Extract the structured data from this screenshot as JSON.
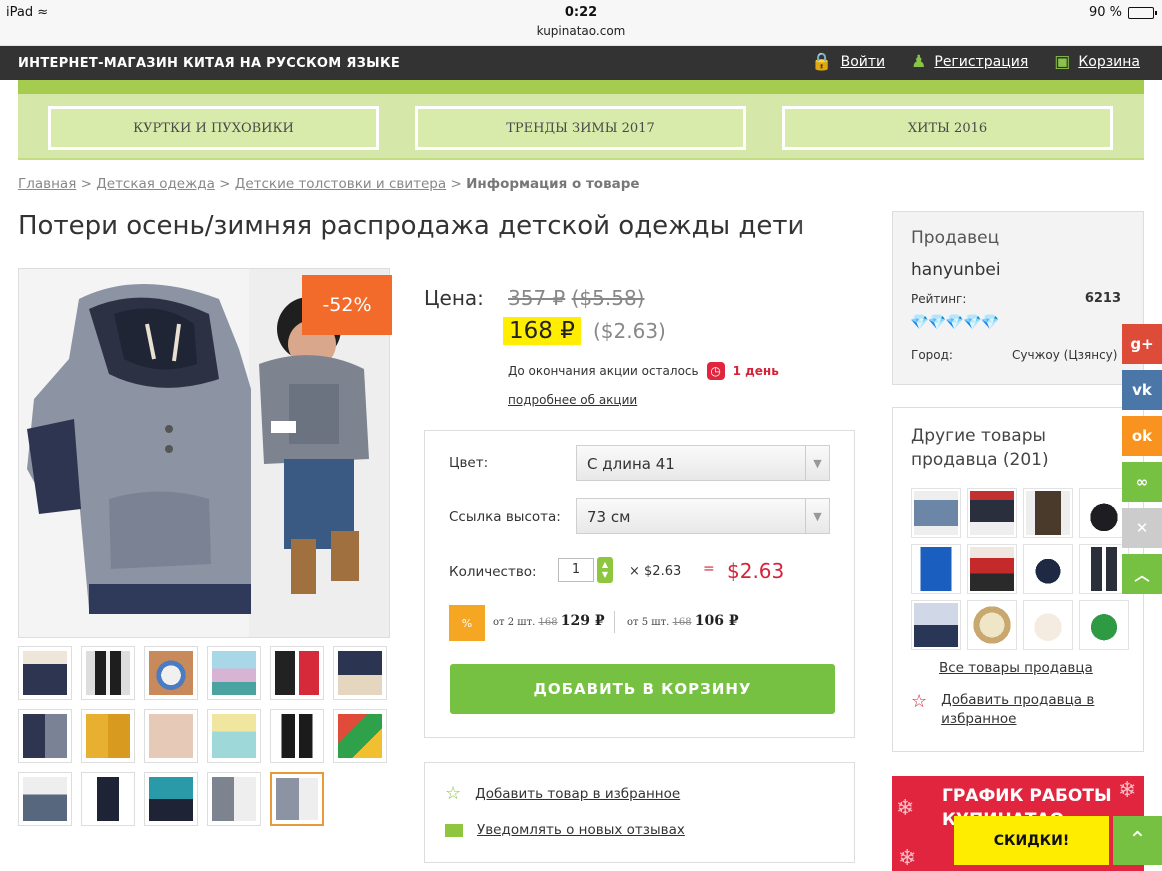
{
  "status_bar": {
    "device": "iPad",
    "time": "0:22",
    "url": "kupinatao.com",
    "battery": "90 %"
  },
  "header": {
    "brand": "ИНТЕРНЕТ-МАГАЗИН КИТАЯ НА РУССКОМ ЯЗЫКЕ",
    "login": "Войти",
    "register": "Регистрация",
    "cart": "Корзина"
  },
  "banners": [
    "КУРТКИ И ПУХОВИКИ",
    "ТРЕНДЫ ЗИМЫ 2017",
    "ХИТЫ 2016"
  ],
  "breadcrumb": {
    "items": [
      "Главная",
      "Детская одежда",
      "Детские толстовки и свитера"
    ],
    "separator": ">",
    "current": "Информация о товаре"
  },
  "product": {
    "title": "Потери осень/зимняя распродажа детской одежды дети",
    "discount": "-52%",
    "price_label": "Цена:",
    "old_price": "357 ₽",
    "old_price_usd": "($5.58)",
    "new_price": "168 ₽",
    "new_price_usd": "($2.63)",
    "promo_until": "До окончания акции осталось",
    "promo_days": "1 день",
    "promo_more": "подробнее об акции"
  },
  "options": {
    "color_label": "Цвет:",
    "color_value": "С длина 41",
    "height_label": "Ссылка высота:",
    "height_value": "73 см",
    "qty_label": "Количество:",
    "qty_value": "1",
    "unit_price": "× $2.63",
    "equals": "=",
    "total": "$2.63",
    "tier_badge": "%",
    "tier1_prefix": "от 2 шт.",
    "tier1_old": "168",
    "tier1_price": "129 ₽",
    "tier2_prefix": "от 5 шт.",
    "tier2_old": "168",
    "tier2_price": "106 ₽",
    "add_to_cart": "ДОБАВИТЬ В КОРЗИНУ"
  },
  "favourites": {
    "add_favourite": "Добавить товар в избранное",
    "notify_reviews": "Уведомлять о новых отзывах"
  },
  "seller": {
    "heading": "Продавец",
    "name": "hanyunbei",
    "rating_label": "Рейтинг:",
    "rating_value": "6213",
    "diamonds": "💎💎💎💎💎",
    "city_label": "Город:",
    "city_value": "Сучжоу (Цзянсу)"
  },
  "other_goods": {
    "heading": "Другие товары продавца (201)",
    "all_link": "Все товары продавца",
    "add_seller_fav": "Добавить продавца в избранное"
  },
  "promo_banner": {
    "line1": "ГРАФИК РАБОТЫ",
    "line2": "КУПИНАТАО"
  },
  "sales_button": "СКИДКИ!",
  "social": [
    {
      "name": "google-plus",
      "label": "g+",
      "color": "#dd4b39"
    },
    {
      "name": "vk",
      "label": "vk",
      "color": "#4a76a8"
    },
    {
      "name": "odnoklassniki",
      "label": "ok",
      "color": "#f7931e"
    },
    {
      "name": "link",
      "label": "∞",
      "color": "#77c142"
    },
    {
      "name": "close",
      "label": "✕",
      "color": "#cccccc"
    },
    {
      "name": "scroll-up",
      "label": "︿",
      "color": "#77c142"
    }
  ],
  "colors": {
    "accent_green": "#77c142",
    "price_highlight": "#ffee00",
    "discount_orange": "#f36b2a",
    "sale_red": "#d4243a"
  }
}
